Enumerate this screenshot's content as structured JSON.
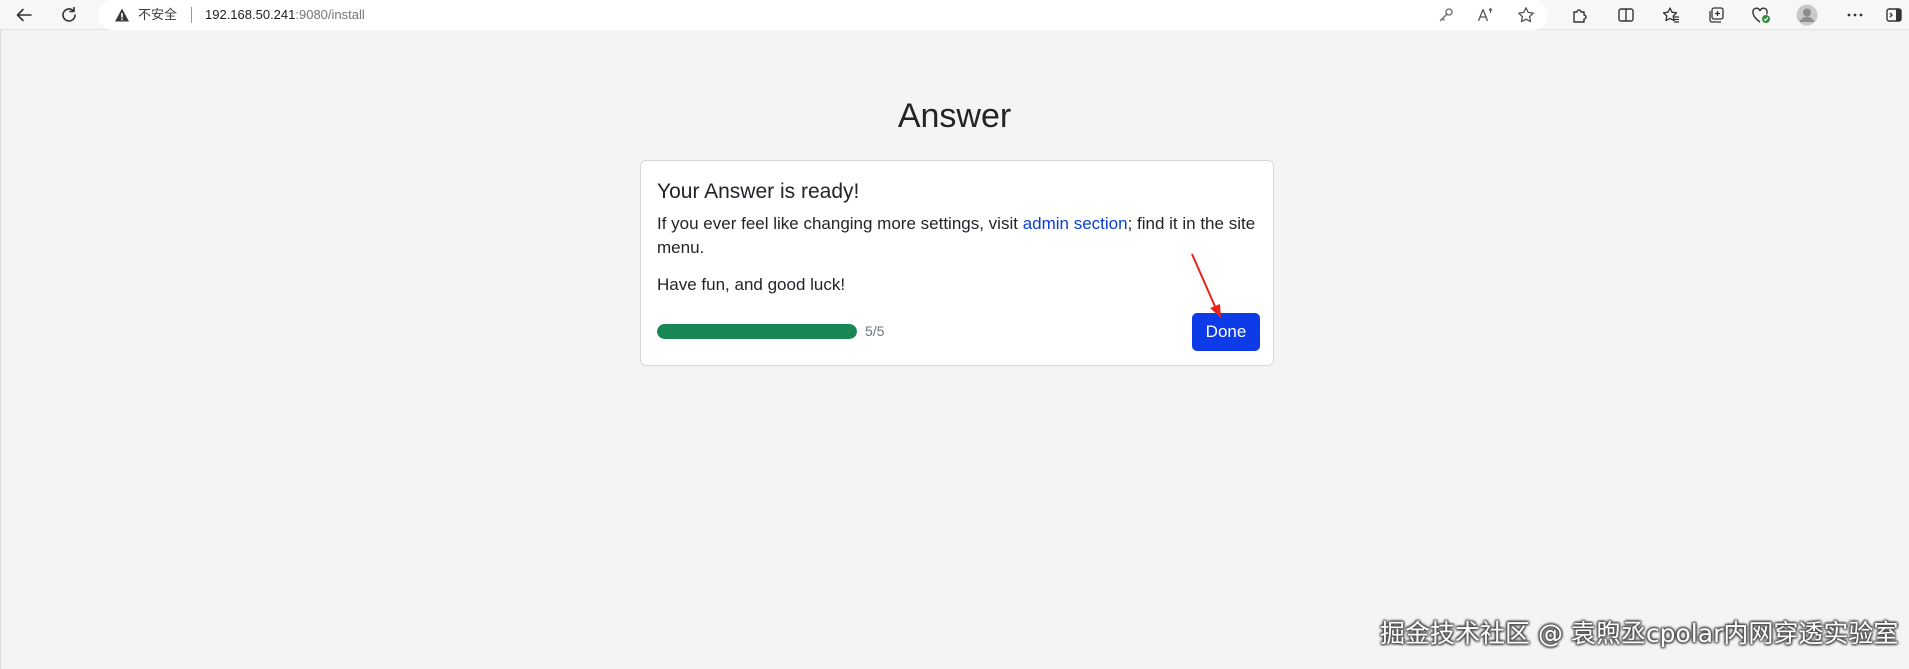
{
  "browser": {
    "security_label": "不安全",
    "url_host": "192.168.50.241",
    "url_rest": ":9080/install",
    "icons": [
      "back-icon",
      "refresh-icon",
      "warning-icon",
      "key-icon",
      "read-aloud-icon",
      "favorite-star-icon",
      "extensions-icon",
      "split-screen-icon",
      "favorites-icon",
      "collections-icon",
      "browser-essentials-icon",
      "profile-avatar-icon",
      "more-icon",
      "sidebar-icon"
    ]
  },
  "page": {
    "title": "Answer"
  },
  "card": {
    "heading": "Your Answer is ready!",
    "text_before": "If you ever feel like changing more settings, visit ",
    "link_text": "admin section",
    "text_after": "; find it in the site menu.",
    "fun_text": "Have fun, and good luck!",
    "progress_fraction": 1.0,
    "progress_label": "5/5",
    "done_label": "Done"
  },
  "colors": {
    "progress": "#198754",
    "primary_button": "#0d3be8",
    "link": "#0a3fd6",
    "annotation_arrow": "#e8231c"
  },
  "watermark": "掘金技术社区 @ 袁煦丞cpolar内网穿透实验室"
}
